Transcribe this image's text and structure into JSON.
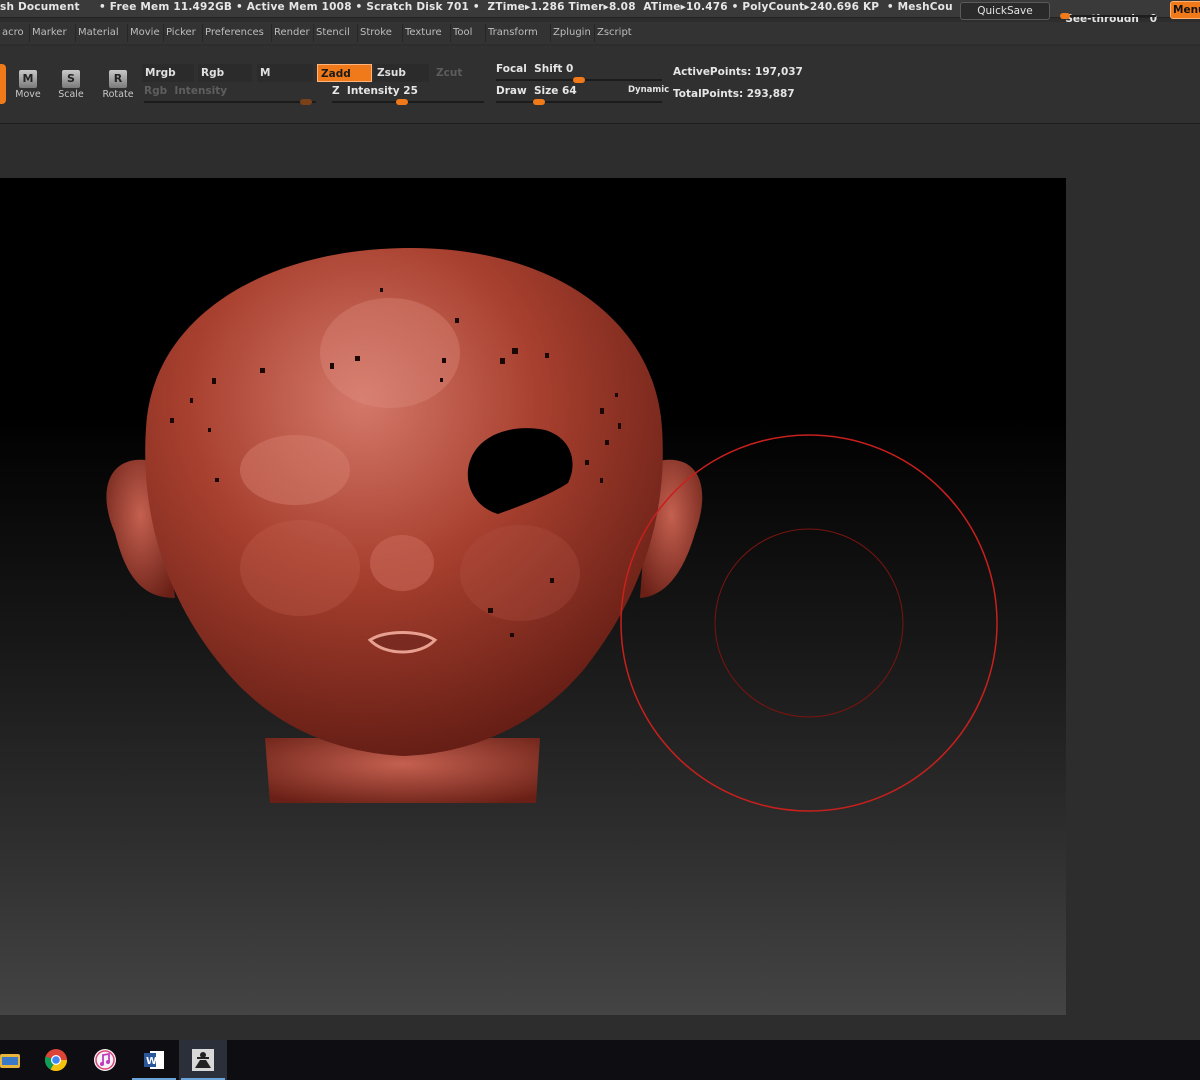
{
  "status_bar": {
    "text": "sh Document     • Free Mem 11.492GB • Active Mem 1008 • Scratch Disk 701 •  ZTime▸1.286 Timer▸8.08  ATime▸10.476 • PolyCount▸240.696 KP  • MeshCou"
  },
  "top_buttons": {
    "quicksave": "QuickSave",
    "see_through_label": "See-through   0",
    "see_through_value": 0,
    "menus": "Menus"
  },
  "menus": [
    "acro",
    "Marker",
    "Material",
    "Movie",
    "Picker",
    "Preferences",
    "Render",
    "Stencil",
    "Stroke",
    "Texture",
    "Tool",
    "Transform",
    "Zplugin",
    "Zscript"
  ],
  "tools": {
    "move": {
      "label": "Move",
      "icon": "move-icon",
      "glyph": "M"
    },
    "scale": {
      "label": "Scale",
      "icon": "scale-icon",
      "glyph": "S"
    },
    "rotate": {
      "label": "Rotate",
      "icon": "rotate-icon",
      "glyph": "R"
    }
  },
  "modes": {
    "mrgb": "Mrgb",
    "rgb": "Rgb",
    "m": "M",
    "zadd": "Zadd",
    "zsub": "Zsub",
    "zcut": "Zcut"
  },
  "sliders": {
    "rgb_intensity": {
      "label": "Rgb  Intensity",
      "value": ""
    },
    "z_intensity": {
      "label": "Z  Intensity 25",
      "value": 25
    },
    "focal_shift": {
      "label": "Focal  Shift 0",
      "value": 0
    },
    "draw_size": {
      "label": "Draw  Size 64",
      "value": 64
    },
    "dynamic": "Dynamic"
  },
  "points": {
    "active": "ActivePoints: 197,037",
    "total": "TotalPoints: 293,887"
  },
  "colors": {
    "accent": "#f07a1a",
    "model_red": "#a8402f",
    "brush_cursor": "#c8201c"
  },
  "taskbar": {
    "apps": [
      "folder-icon",
      "chrome-icon",
      "itunes-icon",
      "word-icon",
      "zbrush-icon"
    ],
    "active": "zbrush-icon"
  }
}
